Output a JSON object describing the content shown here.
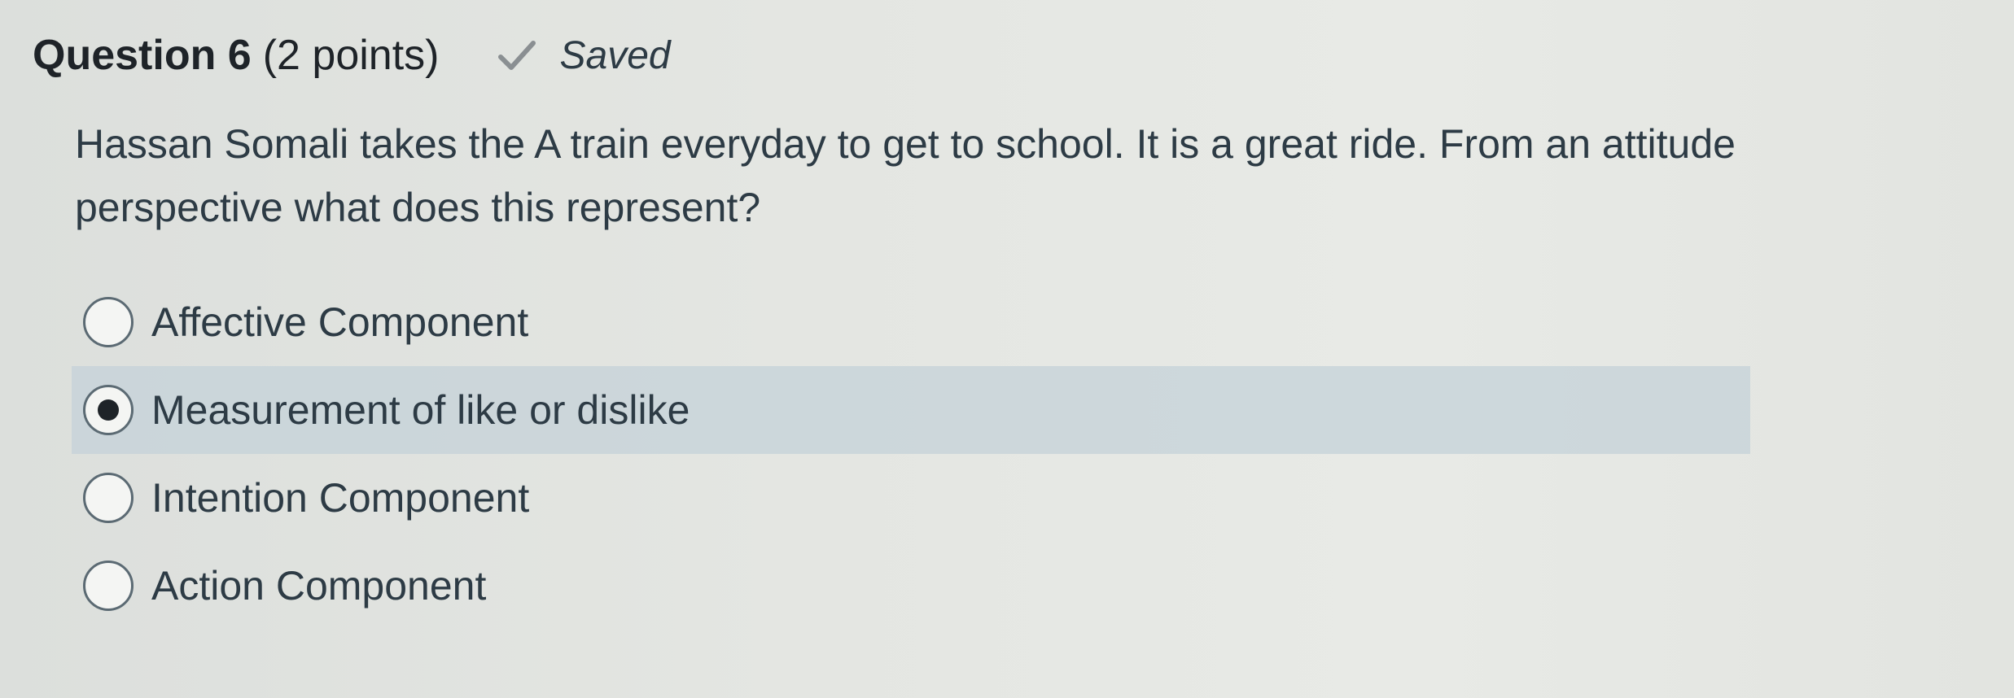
{
  "question": {
    "title": "Question 6",
    "points": "(2 points)",
    "status_text": "Saved",
    "status_icon": "check-icon",
    "text": "Hassan Somali takes the A train everyday to get to school. It is a great ride. From an attitude perspective what does this represent?",
    "options": [
      {
        "label": "Affective Component",
        "selected": false
      },
      {
        "label": "Measurement of like or dislike",
        "selected": true
      },
      {
        "label": "Intention Component",
        "selected": false
      },
      {
        "label": "Action Component",
        "selected": false
      }
    ]
  },
  "colors": {
    "selected_row_bg": "#c4d2d8",
    "text": "#2d3b45",
    "check_mark": "#8a8f92"
  }
}
